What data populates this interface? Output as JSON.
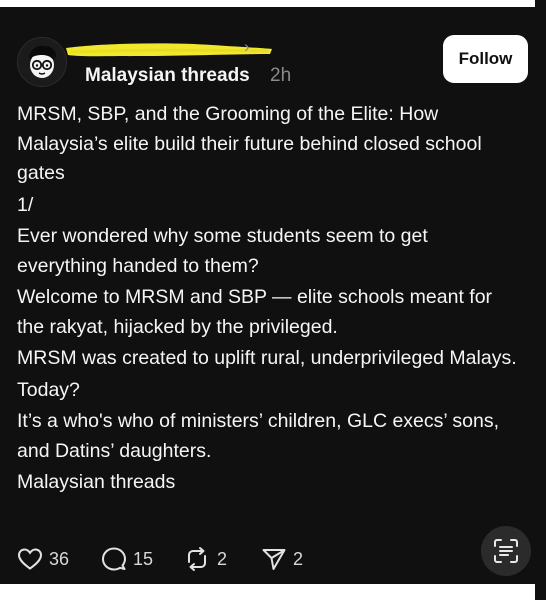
{
  "post": {
    "community": "Malaysian threads",
    "time": "2h",
    "follow_label": "Follow",
    "paragraphs": [
      "MRSM, SBP, and the Grooming of the Elite: How Malaysia’s elite build their future behind closed school gates",
      "1/",
      "Ever wondered why some students seem to get everything handed to them?",
      "Welcome to MRSM and SBP — elite schools meant for the rakyat, hijacked by the privileged.",
      "MRSM was created to uplift rural, underprivileged Malays.",
      "Today?",
      "It’s a who's who of ministers’ children, GLC execs’ sons, and Datins’ daughters.",
      "Malaysian threads"
    ],
    "actions": {
      "likes": "36",
      "replies": "15",
      "reposts": "2",
      "shares": "2"
    }
  },
  "icons": {
    "avatar": "cartoon-face-with-glasses-icon",
    "like": "heart-icon",
    "reply": "speech-bubble-icon",
    "repost": "repost-arrows-icon",
    "share": "send-icon",
    "scan": "text-scan-icon"
  },
  "colors": {
    "background": "#101010",
    "text": "#f3f5f7",
    "muted": "#8a8a8a",
    "redaction": "#f1e82e"
  }
}
